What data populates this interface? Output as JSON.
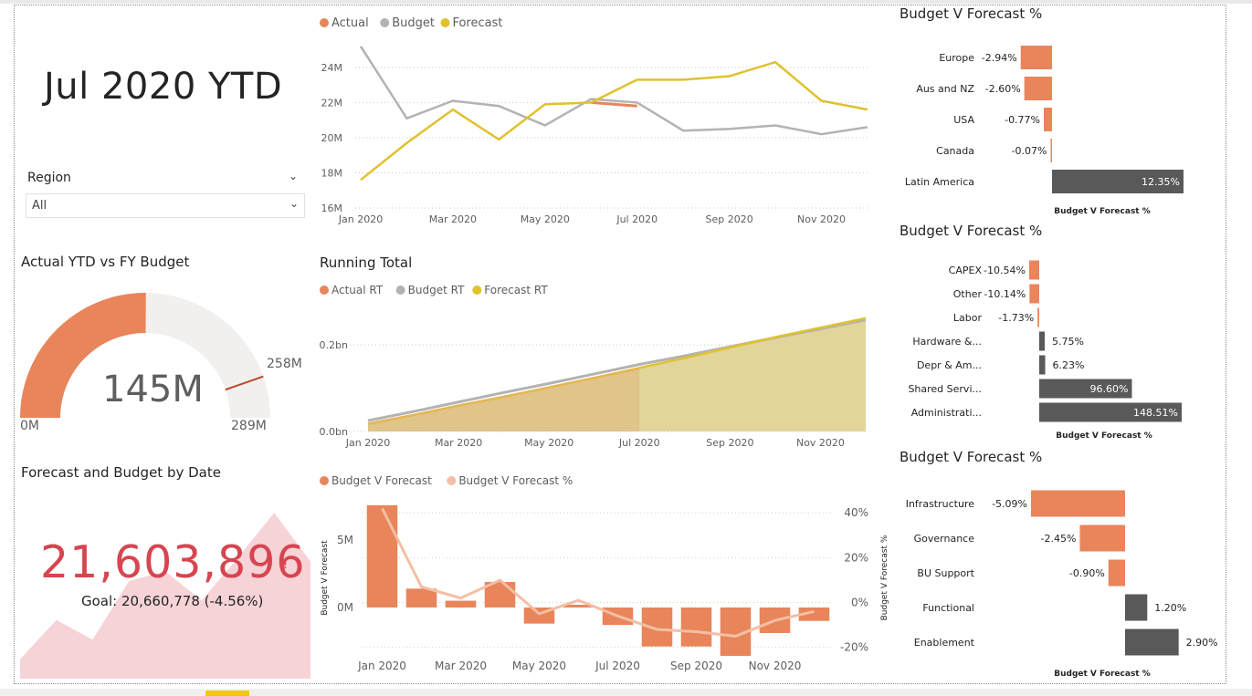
{
  "page": {
    "title": "Jul 2020 YTD"
  },
  "slicer": {
    "label": "Region",
    "value": "All"
  },
  "gauge": {
    "title": "Actual YTD vs FY Budget",
    "value_label": "145M",
    "min_label": "0M",
    "max_label": "289M",
    "target_label": "258M",
    "value": 145,
    "min": 0,
    "max": 289,
    "target": 258
  },
  "kpi": {
    "title": "Forecast and Budget by Date",
    "value": "21,603,896",
    "alert": "!",
    "goal": "Goal: 20,660,778 (-4.56%)",
    "trend": [
      0.1,
      0.3,
      0.2,
      0.5,
      0.55,
      0.4,
      0.62,
      0.85,
      0.6
    ]
  },
  "colors": {
    "actual": "#e8855b",
    "budget": "#b3b3b3",
    "forecast": "#e0c12e",
    "variance_pos": "#e8855b",
    "variance_neg": "#595959",
    "variance_line": "#f4bfa4",
    "kpi_red": "#d64550",
    "kpi_fill": "#f6d3d7",
    "gauge_track": "#f1f0ef"
  },
  "chart_data": [
    {
      "type": "line",
      "legend": [
        "Actual",
        "Budget",
        "Forecast"
      ],
      "x": [
        "Jan 2020",
        "Feb 2020",
        "Mar 2020",
        "Apr 2020",
        "May 2020",
        "Jun 2020",
        "Jul 2020",
        "Aug 2020",
        "Sep 2020",
        "Oct 2020",
        "Nov 2020",
        "Dec 2020"
      ],
      "xticks": [
        "Jan 2020",
        "Mar 2020",
        "May 2020",
        "Jul 2020",
        "Sep 2020",
        "Nov 2020"
      ],
      "yticks": [
        "16M",
        "18M",
        "20M",
        "22M",
        "24M"
      ],
      "ylim": [
        16,
        25.5
      ],
      "series": [
        {
          "name": "Actual",
          "values": [
            null,
            null,
            null,
            null,
            null,
            22.0,
            21.8,
            null,
            null,
            null,
            null,
            null
          ]
        },
        {
          "name": "Budget",
          "values": [
            25.2,
            21.1,
            22.1,
            21.8,
            20.7,
            22.2,
            22.0,
            20.4,
            20.5,
            20.7,
            20.2,
            20.6
          ]
        },
        {
          "name": "Forecast",
          "values": [
            17.6,
            19.7,
            21.6,
            19.9,
            21.9,
            22.0,
            23.3,
            23.3,
            23.5,
            24.3,
            22.1,
            21.6
          ]
        }
      ]
    },
    {
      "type": "area",
      "title": "Running Total",
      "legend": [
        "Actual RT",
        "Budget RT",
        "Forecast RT"
      ],
      "x": [
        "Jan 2020",
        "Feb 2020",
        "Mar 2020",
        "Apr 2020",
        "May 2020",
        "Jun 2020",
        "Jul 2020",
        "Aug 2020",
        "Sep 2020",
        "Oct 2020",
        "Nov 2020",
        "Dec 2020"
      ],
      "xticks": [
        "Jan 2020",
        "Mar 2020",
        "May 2020",
        "Jul 2020",
        "Sep 2020",
        "Nov 2020"
      ],
      "yticks": [
        "0.0bn",
        "0.2bn"
      ],
      "ylim": [
        0,
        0.27
      ],
      "series": [
        {
          "name": "Actual RT",
          "values": [
            0.018,
            0.038,
            0.06,
            0.081,
            0.102,
            0.124,
            0.145,
            null,
            null,
            null,
            null,
            null
          ]
        },
        {
          "name": "Budget RT",
          "values": [
            0.025,
            0.046,
            0.068,
            0.09,
            0.111,
            0.133,
            0.155,
            0.175,
            0.196,
            0.217,
            0.237,
            0.258
          ]
        },
        {
          "name": "Forecast RT",
          "values": [
            0.018,
            0.038,
            0.06,
            0.08,
            0.102,
            0.124,
            0.147,
            0.17,
            0.194,
            0.218,
            0.24,
            0.262
          ]
        }
      ]
    },
    {
      "type": "bar",
      "legend": [
        "Budget V Forecast",
        "Budget V Forecast %"
      ],
      "x": [
        "Jan 2020",
        "Feb 2020",
        "Mar 2020",
        "Apr 2020",
        "May 2020",
        "Jun 2020",
        "Jul 2020",
        "Aug 2020",
        "Sep 2020",
        "Oct 2020",
        "Nov 2020",
        "Dec 2020"
      ],
      "xticks": [
        "Jan 2020",
        "Mar 2020",
        "May 2020",
        "Jul 2020",
        "Sep 2020",
        "Nov 2020"
      ],
      "ylabel": "Budget V Forecast",
      "y2label": "Budget V Forecast %",
      "yticks": [
        "0M",
        "5M"
      ],
      "y2ticks": [
        "-20%",
        "0%",
        "20%",
        "40%"
      ],
      "ylim": [
        -3.8,
        8.2
      ],
      "y2lim": [
        -25,
        47
      ],
      "series": [
        {
          "name": "Budget V Forecast",
          "values": [
            7.6,
            1.4,
            0.5,
            1.9,
            -1.2,
            0.2,
            -1.3,
            -2.9,
            -2.9,
            -3.6,
            -1.9,
            -1.0
          ]
        },
        {
          "name": "Budget V Forecast %",
          "values": [
            42,
            7,
            2,
            10,
            -5,
            1,
            -6,
            -12,
            -13,
            -15,
            -8,
            -4
          ]
        }
      ]
    },
    {
      "type": "bar",
      "title": "Budget V Forecast %",
      "xlabel": "Budget V Forecast %",
      "categories": [
        "Europe",
        "Aus and NZ",
        "USA",
        "Canada",
        "Latin America"
      ],
      "labels": [
        "-2.94%",
        "-2.60%",
        "-0.77%",
        "-0.07%",
        "12.35%"
      ],
      "values": [
        -2.94,
        -2.6,
        -0.77,
        -0.07,
        12.35
      ]
    },
    {
      "type": "bar",
      "title": "Budget V Forecast %",
      "xlabel": "Budget V Forecast %",
      "categories": [
        "CAPEX",
        "Other",
        "Labor",
        "Hardware &...",
        "Depr & Am...",
        "Shared Servi...",
        "Administrati..."
      ],
      "labels": [
        "-10.54%",
        "-10.14%",
        "-1.73%",
        "5.75%",
        "6.23%",
        "96.60%",
        "148.51%"
      ],
      "values": [
        -10.54,
        -10.14,
        -1.73,
        5.75,
        6.23,
        96.6,
        148.51
      ]
    },
    {
      "type": "bar",
      "title": "Budget V Forecast %",
      "xlabel": "Budget V Forecast %",
      "categories": [
        "Infrastructure",
        "Governance",
        "BU Support",
        "Functional",
        "Enablement"
      ],
      "labels": [
        "-5.09%",
        "-2.45%",
        "-0.90%",
        "1.20%",
        "2.90%"
      ],
      "values": [
        -5.09,
        -2.45,
        -0.9,
        1.2,
        2.9
      ]
    }
  ]
}
